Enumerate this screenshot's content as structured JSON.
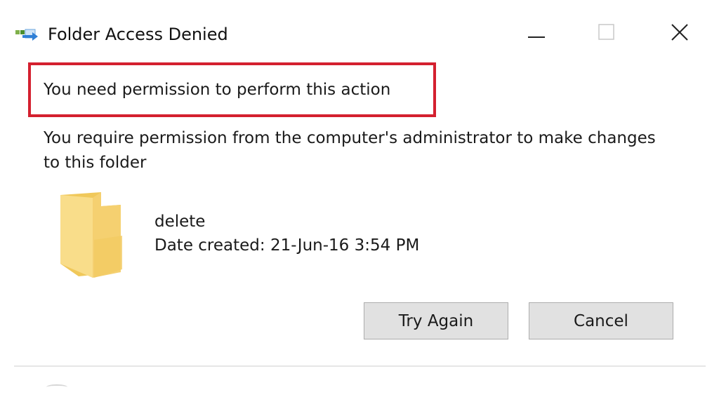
{
  "window": {
    "title": "Folder Access Denied",
    "icon": "folder-move-icon",
    "controls": [
      "minimize-icon",
      "maximize-icon",
      "close-icon"
    ]
  },
  "content": {
    "heading": "You need permission to perform this action",
    "message": "You require permission from the computer's administrator to make changes to this folder",
    "highlight_color": "#d4202f"
  },
  "folder": {
    "icon": "folder-icon",
    "name": "delete",
    "date_created": "Date created: 21-Jun-16 3:54 PM"
  },
  "buttons": {
    "try_again_label": "Try Again",
    "cancel_label": "Cancel"
  },
  "colors": {
    "button_bg": "#e1e1e1",
    "button_border": "#adadad",
    "folder_yellow": "#f8d775"
  }
}
